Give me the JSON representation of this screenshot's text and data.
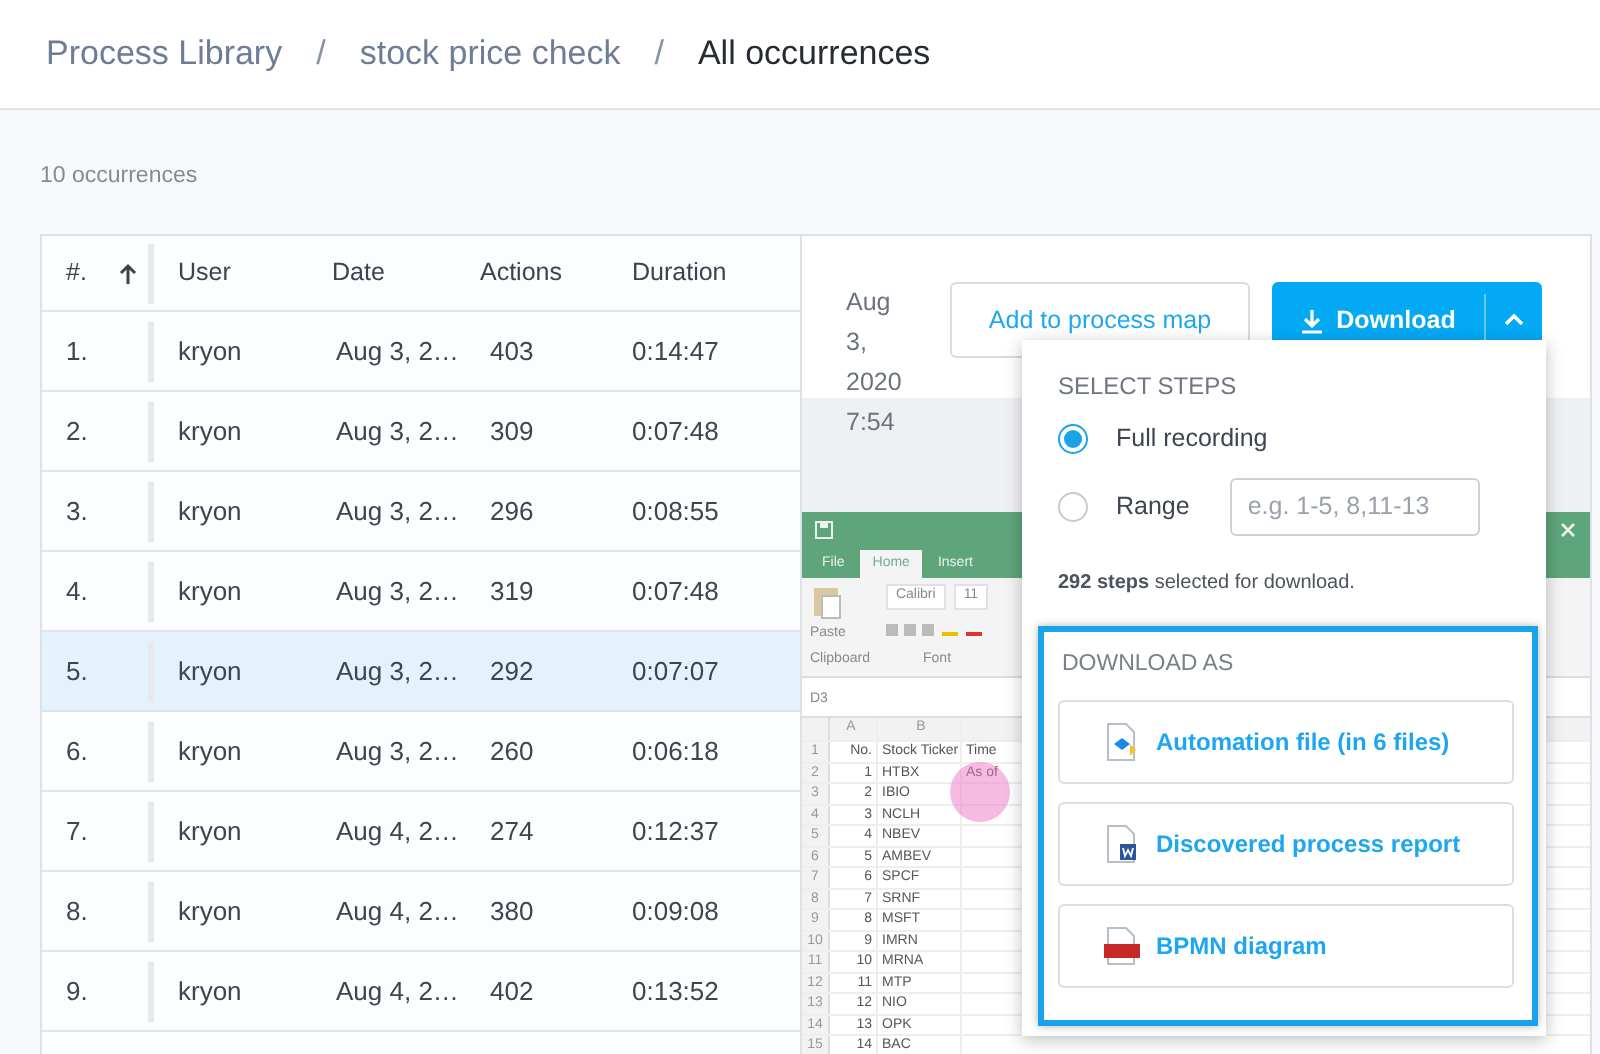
{
  "breadcrumb": {
    "items": [
      {
        "label": "Process Library",
        "current": false
      },
      {
        "label": "stock price check",
        "current": false
      },
      {
        "label": "All occurrences",
        "current": true
      }
    ],
    "separators": [
      "/",
      "/"
    ]
  },
  "count": "10 occurrences",
  "table": {
    "columns": [
      {
        "label": "#.",
        "sorted_ascending": true
      },
      {
        "label": "User",
        "sorted_ascending": false
      },
      {
        "label": "Date",
        "sorted_ascending": false
      },
      {
        "label": "Actions",
        "sorted_ascending": false
      },
      {
        "label": "Duration",
        "sorted_ascending": false
      }
    ],
    "rows": [
      {
        "cells": [
          "1.",
          "kryon",
          "Aug 3, 2…",
          "403",
          "0:14:47"
        ],
        "selected": false
      },
      {
        "cells": [
          "2.",
          "kryon",
          "Aug 3, 2…",
          "309",
          "0:07:48"
        ],
        "selected": false
      },
      {
        "cells": [
          "3.",
          "kryon",
          "Aug 3, 2…",
          "296",
          "0:08:55"
        ],
        "selected": false
      },
      {
        "cells": [
          "4.",
          "kryon",
          "Aug 3, 2…",
          "319",
          "0:07:48"
        ],
        "selected": false
      },
      {
        "cells": [
          "5.",
          "kryon",
          "Aug 3, 2…",
          "292",
          "0:07:07"
        ],
        "selected": true
      },
      {
        "cells": [
          "6.",
          "kryon",
          "Aug 3, 2…",
          "260",
          "0:06:18"
        ],
        "selected": false
      },
      {
        "cells": [
          "7.",
          "kryon",
          "Aug 4, 2…",
          "274",
          "0:12:37"
        ],
        "selected": false
      },
      {
        "cells": [
          "8.",
          "kryon",
          "Aug 4, 2…",
          "380",
          "0:09:08"
        ],
        "selected": false
      },
      {
        "cells": [
          "9.",
          "kryon",
          "Aug 4, 2…",
          "402",
          "0:13:52"
        ],
        "selected": false
      }
    ]
  },
  "details": {
    "date": "Aug 3, 2020 7:54",
    "buttons": [
      {
        "label": "Add to process map",
        "kind": "outline"
      },
      {
        "label": "Download",
        "kind": "split",
        "expanded": true
      }
    ],
    "excel": {
      "tabs": [
        {
          "label": "File",
          "selected": false
        },
        {
          "label": "Home",
          "selected": true
        },
        {
          "label": "Insert",
          "selected": false
        }
      ],
      "ribbon_labels": [
        "Paste",
        "Clipboard",
        "Font"
      ],
      "font_name": "Calibri",
      "font_size": "11",
      "name_box": "D3",
      "column_headers": [
        "A",
        "B"
      ],
      "rows": [
        [
          "1",
          "No.",
          "Stock Ticker",
          "Time"
        ],
        [
          "2",
          "1",
          "HTBX",
          "As of"
        ],
        [
          "3",
          "2",
          "IBIO",
          ""
        ],
        [
          "4",
          "3",
          "NCLH",
          ""
        ],
        [
          "5",
          "4",
          "NBEV",
          ""
        ],
        [
          "6",
          "5",
          "AMBEV",
          ""
        ],
        [
          "7",
          "6",
          "SPCF",
          ""
        ],
        [
          "8",
          "7",
          "SRNF",
          ""
        ],
        [
          "9",
          "8",
          "MSFT",
          ""
        ],
        [
          "10",
          "9",
          "IMRN",
          ""
        ],
        [
          "11",
          "10",
          "MRNA",
          ""
        ],
        [
          "12",
          "11",
          "MTP",
          ""
        ],
        [
          "13",
          "12",
          "NIO",
          ""
        ],
        [
          "14",
          "13",
          "OPK",
          ""
        ],
        [
          "15",
          "14",
          "BAC",
          ""
        ]
      ]
    },
    "download_menu": {
      "title": "SELECT STEPS",
      "options": [
        {
          "label": "Full recording",
          "selected": true
        },
        {
          "label": "Range",
          "selected": false,
          "placeholder": "e.g. 1-5, 8,11-13"
        }
      ],
      "summary": "**292 steps** selected for download.",
      "format_title": "DOWNLOAD AS",
      "formats": [
        {
          "label": "Automation file (in 6 files)",
          "kind": "automation"
        },
        {
          "label": "Discovered process report",
          "kind": "word"
        },
        {
          "label": "BPMN diagram",
          "kind": "bpmn"
        }
      ]
    }
  }
}
